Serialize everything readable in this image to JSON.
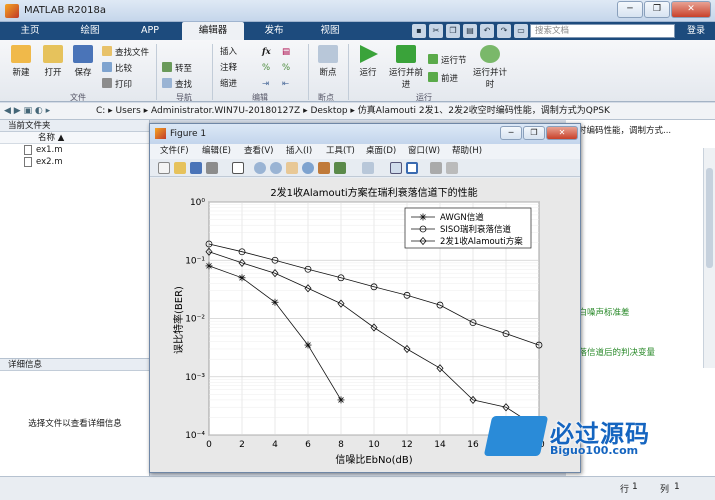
{
  "window": {
    "title": "MATLAB R2018a",
    "buttons": [
      "─",
      "❐",
      "✕"
    ]
  },
  "tabs": [
    "主页",
    "绘图",
    "APP",
    "编辑器",
    "发布",
    "视图"
  ],
  "search": {
    "placeholder": "搜索文档"
  },
  "login": "登录",
  "ribbon": {
    "buttons": {
      "new": "新建",
      "open": "打开",
      "save": "保存",
      "find_file": "查找文件",
      "compare": "比较",
      "print": "打印",
      "goto": "转至",
      "find": "查找",
      "insert": "插入",
      "comment": "注释",
      "indent": "缩进",
      "breakpoints": "断点",
      "run": "运行",
      "run_advance": "运行并前进",
      "run_section": "运行节",
      "advance": "前进",
      "run_time": "运行并计时"
    },
    "groups": {
      "file": "文件",
      "navigate": "导航",
      "edit": "编辑",
      "breakpoints": "断点",
      "run": "运行"
    },
    "fx": "fx"
  },
  "address": {
    "path": "C: ▸ Users ▸ Administrator.WIN7U-20180127Z ▸ Desktop ▸ 仿真Alamouti 2发1、2发2收空时编码性能，调制方式为QPSK"
  },
  "current_folder": {
    "title": "当前文件夹",
    "column": "名称 ▲",
    "files": [
      "ex1.m",
      "ex2.m"
    ]
  },
  "details": {
    "title": "详细信息",
    "message": "选择文件以查看详细信息"
  },
  "right_text": {
    "header": "时编码性能，调制方式...",
    "line1": "斤白噪声标准差",
    "line2": "衰落信道后的判决变量"
  },
  "status": {
    "row_label": "行",
    "row": "1",
    "col_label": "列",
    "col": "1"
  },
  "figure": {
    "title": "Figure 1",
    "menu": [
      "文件(F)",
      "编辑(E)",
      "查看(V)",
      "插入(I)",
      "工具(T)",
      "桌面(D)",
      "窗口(W)",
      "帮助(H)"
    ]
  },
  "chart_data": {
    "type": "line",
    "title": "2发1收Alamouti方案在瑞利衰落信道下的性能",
    "xlabel": "信噪比EbNo(dB)",
    "ylabel": "误比特率(BER)",
    "xlim": [
      0,
      20
    ],
    "ylim": [
      0.0001,
      1
    ],
    "yscale": "log",
    "grid": true,
    "legend_position": "top-right",
    "x_ticks": [
      "0",
      "2",
      "4",
      "6",
      "8",
      "10",
      "12",
      "14",
      "16",
      "18",
      "20"
    ],
    "y_ticks": [
      "10⁻⁴",
      "10⁻³",
      "10⁻²",
      "10⁻¹",
      "10⁰"
    ],
    "series": [
      {
        "name": "AWGN信道",
        "marker": "star",
        "x": [
          0,
          2,
          4,
          6,
          8
        ],
        "values": [
          0.08,
          0.05,
          0.019,
          0.0035,
          0.0004
        ]
      },
      {
        "name": "SISO瑞利衰落信道",
        "marker": "circle",
        "x": [
          0,
          2,
          4,
          6,
          8,
          10,
          12,
          14,
          16,
          18,
          20
        ],
        "values": [
          0.19,
          0.14,
          0.1,
          0.07,
          0.05,
          0.035,
          0.025,
          0.017,
          0.0085,
          0.0055,
          0.0035
        ]
      },
      {
        "name": "2发1收Alamouti方案",
        "marker": "diamond",
        "x": [
          0,
          2,
          4,
          6,
          8,
          10,
          12,
          14,
          16,
          18,
          20
        ],
        "values": [
          0.14,
          0.09,
          0.06,
          0.033,
          0.018,
          0.007,
          0.003,
          0.0014,
          0.0004,
          0.0003,
          0.00013
        ]
      }
    ]
  },
  "watermark": {
    "big": "必过源码",
    "small": "Biguo100.com"
  }
}
